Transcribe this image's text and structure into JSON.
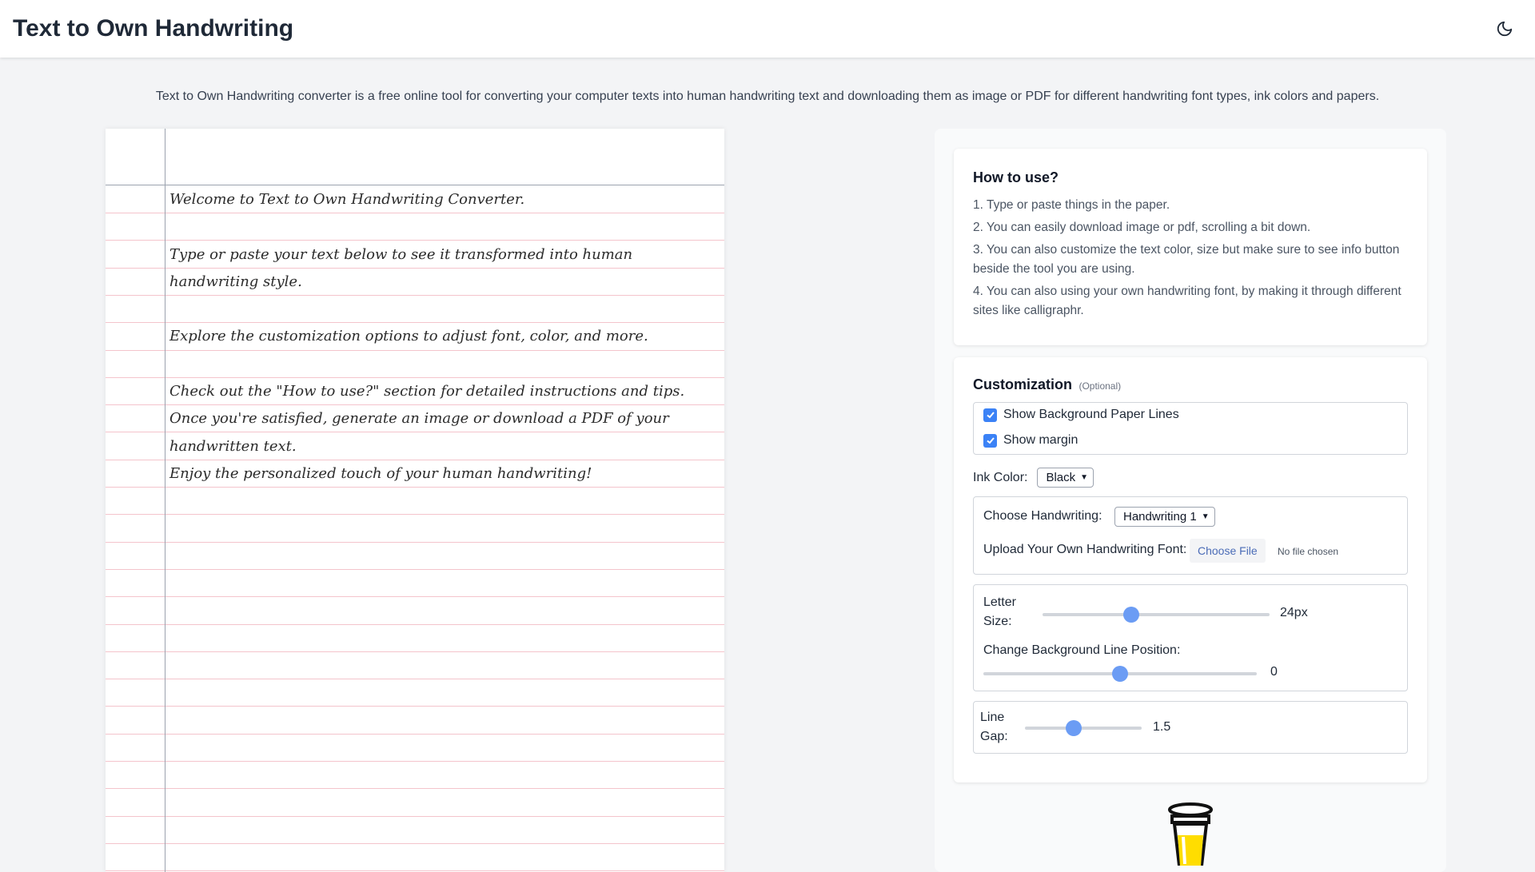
{
  "header": {
    "title": "Text to Own Handwriting",
    "theme_icon": "moon-icon"
  },
  "intro_text": "Text to Own Handwriting converter is a free online tool for converting your computer texts into human handwriting text and downloading them as image or PDF for different handwriting font types, ink colors and papers.",
  "paper": {
    "content": "Welcome to Text to Own Handwriting Converter.\n\nType or paste your text below to see it transformed into human handwriting style.\n\nExplore the customization options to adjust font, color, and more.\n\nCheck out the \"How to use?\" section for detailed instructions and tips.\nOnce you're satisfied, generate an image or download a PDF of your handwritten text.\nEnjoy the personalized touch of your human handwriting!"
  },
  "how_to": {
    "title": "How to use?",
    "steps": [
      "1. Type or paste things in the paper.",
      "2. You can easily download image or pdf, scrolling a bit down.",
      "3. You can also customize the text color, size but make sure to see info button beside the tool you are using.",
      "4. You can also using your own handwriting font, by making it through different sites like calligraphr."
    ]
  },
  "customization": {
    "title": "Customization",
    "optional_label": "(Optional)",
    "show_lines_label": "Show Background Paper Lines",
    "show_lines_checked": true,
    "show_margin_label": "Show margin",
    "show_margin_checked": true,
    "ink_color_label": "Ink Color:",
    "ink_color_value": "Black",
    "handwriting_label": "Choose Handwriting:",
    "handwriting_value": "Handwriting 1",
    "upload_label": "Upload Your Own Handwriting Font:",
    "choose_file_label": "Choose File",
    "file_status": "No file chosen",
    "letter_size_label": "Letter Size:",
    "letter_size_value": "24px",
    "letter_size_fraction": 0.39,
    "line_position_label": "Change Background Line Position:",
    "line_position_value": "0",
    "line_position_fraction": 0.5,
    "line_gap_label": "Line Gap:",
    "line_gap_value": "1.5",
    "line_gap_fraction": 0.42
  },
  "colors": {
    "accent": "#3b82f6",
    "slider_thumb": "#6b9cf4",
    "paper_rule": "#f4c4cc",
    "cup_fill": "#ffdd00"
  }
}
